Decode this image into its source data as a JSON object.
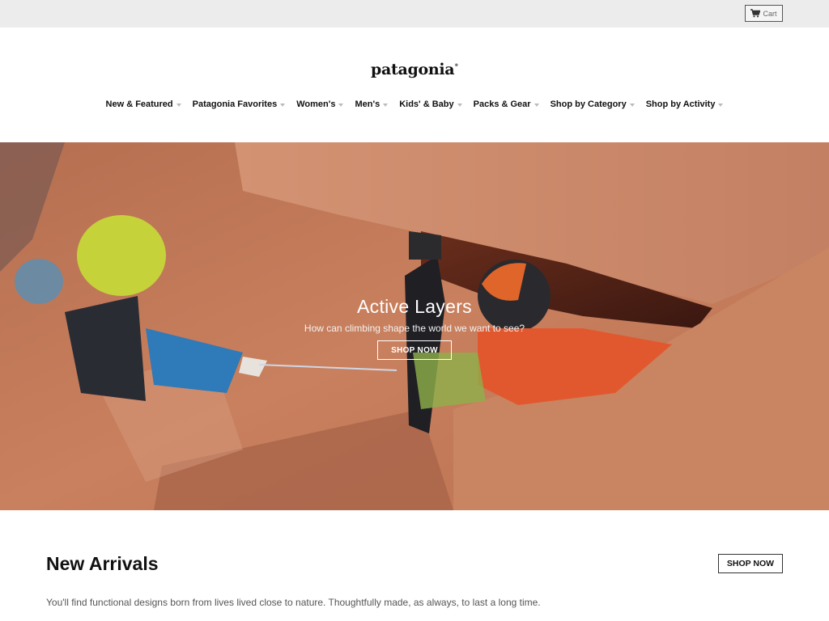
{
  "topbar": {
    "cart_label": "Cart",
    "cart_icon": "cart-icon"
  },
  "header": {
    "logo": "patagonia",
    "logo_mark": "®",
    "nav": [
      {
        "label": "New & Featured"
      },
      {
        "label": "Patagonia Favorites"
      },
      {
        "label": "Women's"
      },
      {
        "label": "Men's"
      },
      {
        "label": "Kids' & Baby"
      },
      {
        "label": "Packs & Gear"
      },
      {
        "label": "Shop by Category"
      },
      {
        "label": "Shop by Activity"
      }
    ]
  },
  "hero": {
    "title": "Active Layers",
    "subtitle": "How can climbing shape the world we want to see?",
    "cta": "SHOP NOW"
  },
  "new_arrivals": {
    "title": "New Arrivals",
    "cta": "SHOP NOW",
    "description": "You'll find functional designs born from lives lived close to nature. Thoughtfully made, as always, to last a long time."
  },
  "colors": {
    "topbar_bg": "#ececec",
    "hero_rock": "#c07a5a",
    "text": "#111111"
  }
}
